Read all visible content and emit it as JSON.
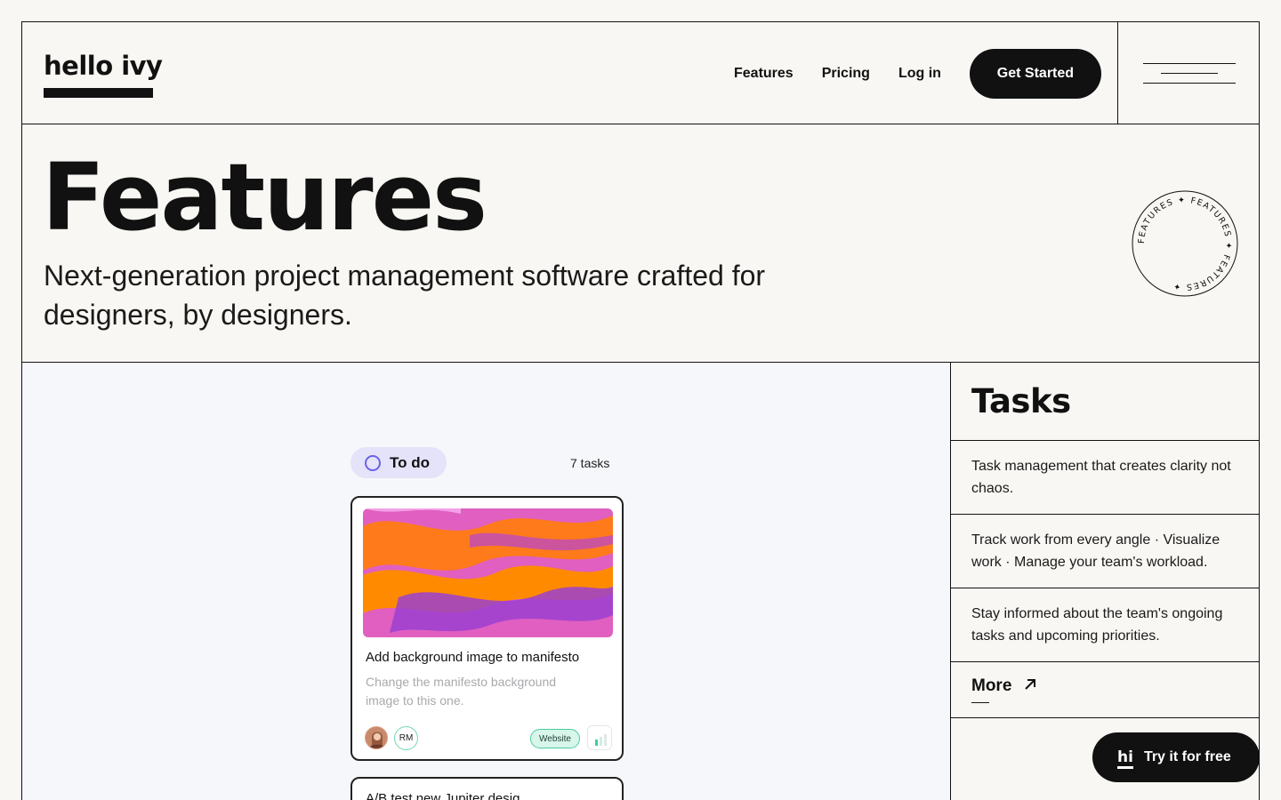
{
  "brand": {
    "logo_text": "hello ivy"
  },
  "nav": {
    "links": [
      "Features",
      "Pricing",
      "Log in"
    ],
    "cta": "Get Started"
  },
  "hero": {
    "title": "Features",
    "subtitle": "Next-generation project management software crafted for designers, by designers.",
    "badge_text": "FEATURES ✦ FEATURES ✦ FEATURES ✦"
  },
  "tasks_panel": {
    "title": "Tasks",
    "items": [
      "Task management that creates clarity not chaos.",
      "Track work from every angle  ·  Visualize work  ·  Manage your team's workload.",
      "Stay informed about the team's ongoing tasks and upcoming priorities."
    ],
    "more_label": "More"
  },
  "board": {
    "column_label": "To do",
    "task_count": "7 tasks",
    "card": {
      "title": "Add background image to manifesto",
      "description": "Change the manifesto background image to this one.",
      "assignee_initials": "RM",
      "tag": "Website"
    },
    "card2_title": "A/B test new Jupiter desig"
  },
  "floating_cta": {
    "logo": "hi",
    "label": "Try it for free"
  },
  "colors": {
    "ink": "#111111",
    "paper": "#f9f7f3",
    "todo_accent": "#6b63e6",
    "tag_green": "#48cda0"
  }
}
